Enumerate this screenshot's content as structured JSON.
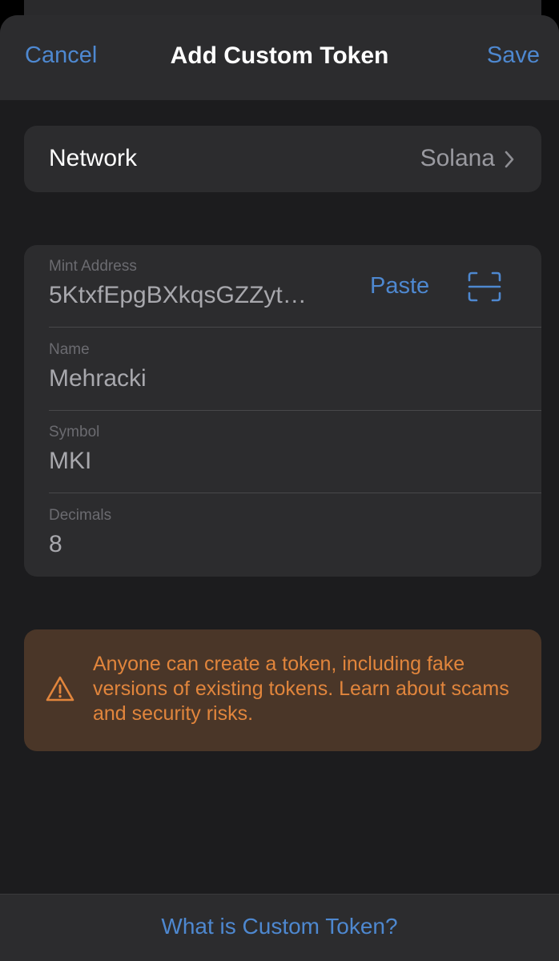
{
  "header": {
    "cancel_label": "Cancel",
    "title": "Add Custom Token",
    "save_label": "Save"
  },
  "network": {
    "label": "Network",
    "value": "Solana"
  },
  "fields": {
    "mint_address": {
      "label": "Mint Address",
      "value": "5KtxfEpgBXkqsGZZyt…",
      "paste_label": "Paste"
    },
    "name": {
      "label": "Name",
      "value": "Mehracki"
    },
    "symbol": {
      "label": "Symbol",
      "value": "MKI"
    },
    "decimals": {
      "label": "Decimals",
      "value": "8"
    }
  },
  "warning": {
    "text": "Anyone can create a token, including fake versions of existing tokens. Learn about scams and security risks."
  },
  "footer": {
    "link_label": "What is Custom Token?"
  },
  "icons": {
    "chevron": "chevron-right-icon",
    "scan": "scan-qr-icon",
    "warning": "warning-triangle-icon"
  },
  "colors": {
    "accent": "#4e88d0",
    "warning_text": "#e1853c",
    "warning_bg": "#4a3628",
    "background": "#1c1c1e",
    "card": "#2c2c2e"
  }
}
